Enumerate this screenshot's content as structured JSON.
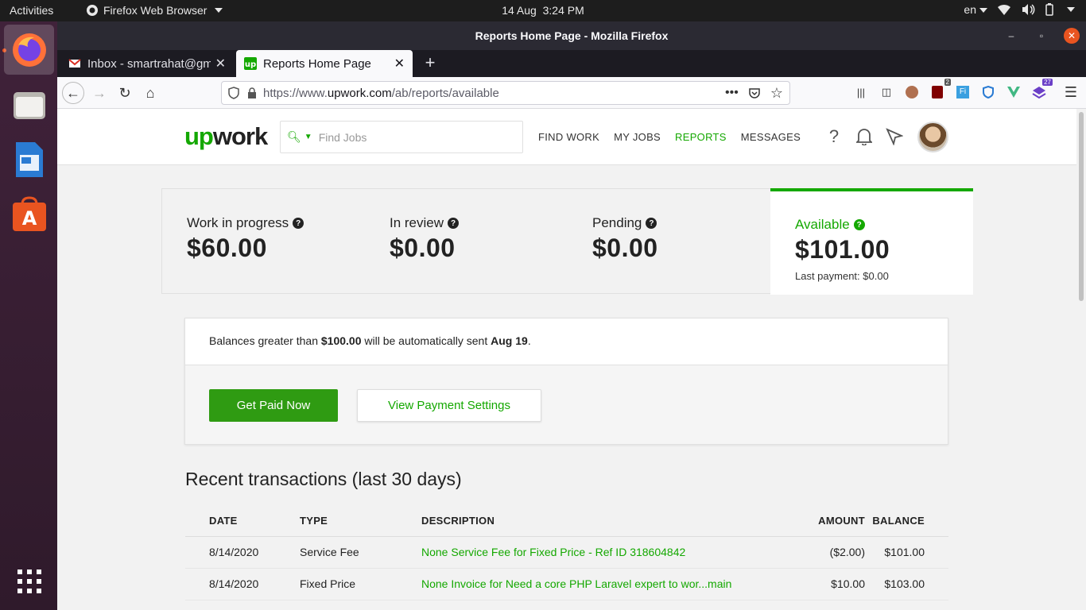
{
  "topbar": {
    "activities": "Activities",
    "app_name": "Firefox Web Browser",
    "clock_date": "14 Aug",
    "clock_time": "3:24 PM",
    "lang": "en"
  },
  "window": {
    "title": "Reports Home Page - Mozilla Firefox"
  },
  "tabs": [
    {
      "title": "Inbox - smartrahat@gmail.com",
      "favicon": "gmail-icon"
    },
    {
      "title": "Reports Home Page",
      "favicon": "upwork-icon"
    }
  ],
  "url": {
    "prefix": "https://www.",
    "domain": "upwork.com",
    "path": "/ab/reports/available"
  },
  "toolbar_badges": {
    "ublock": "2",
    "extension": "27"
  },
  "header": {
    "logo_up": "up",
    "logo_work": "work",
    "search_placeholder": "Find Jobs",
    "nav": [
      "FIND WORK",
      "MY JOBS",
      "REPORTS",
      "MESSAGES"
    ]
  },
  "balances": {
    "wip_label": "Work in progress",
    "wip_amount": "$60.00",
    "review_label": "In review",
    "review_amount": "$0.00",
    "pending_label": "Pending",
    "pending_amount": "$0.00",
    "available_label": "Available",
    "available_amount": "$101.00",
    "last_payment": "Last payment: $0.00"
  },
  "payment": {
    "note_prefix": "Balances greater than ",
    "note_threshold": "$100.00",
    "note_middle": " will be automatically sent ",
    "note_date": "Aug 19",
    "note_suffix": ".",
    "get_paid_label": "Get Paid Now",
    "view_settings_label": "View Payment Settings"
  },
  "transactions": {
    "title": "Recent transactions (last 30 days)",
    "headers": {
      "date": "DATE",
      "type": "TYPE",
      "description": "DESCRIPTION",
      "amount": "AMOUNT",
      "balance": "BALANCE"
    },
    "rows": [
      {
        "date": "8/14/2020",
        "type": "Service Fee",
        "description": "None Service Fee for Fixed Price - Ref ID 318604842",
        "amount": "($2.00)",
        "balance": "$101.00"
      },
      {
        "date": "8/14/2020",
        "type": "Fixed Price",
        "description": "None Invoice for Need a core PHP Laravel expert to wor...main",
        "amount": "$10.00",
        "balance": "$103.00"
      }
    ]
  },
  "colors": {
    "upwork_green": "#14a800",
    "button_green": "#2f9b12",
    "ubuntu_orange": "#e95420"
  }
}
